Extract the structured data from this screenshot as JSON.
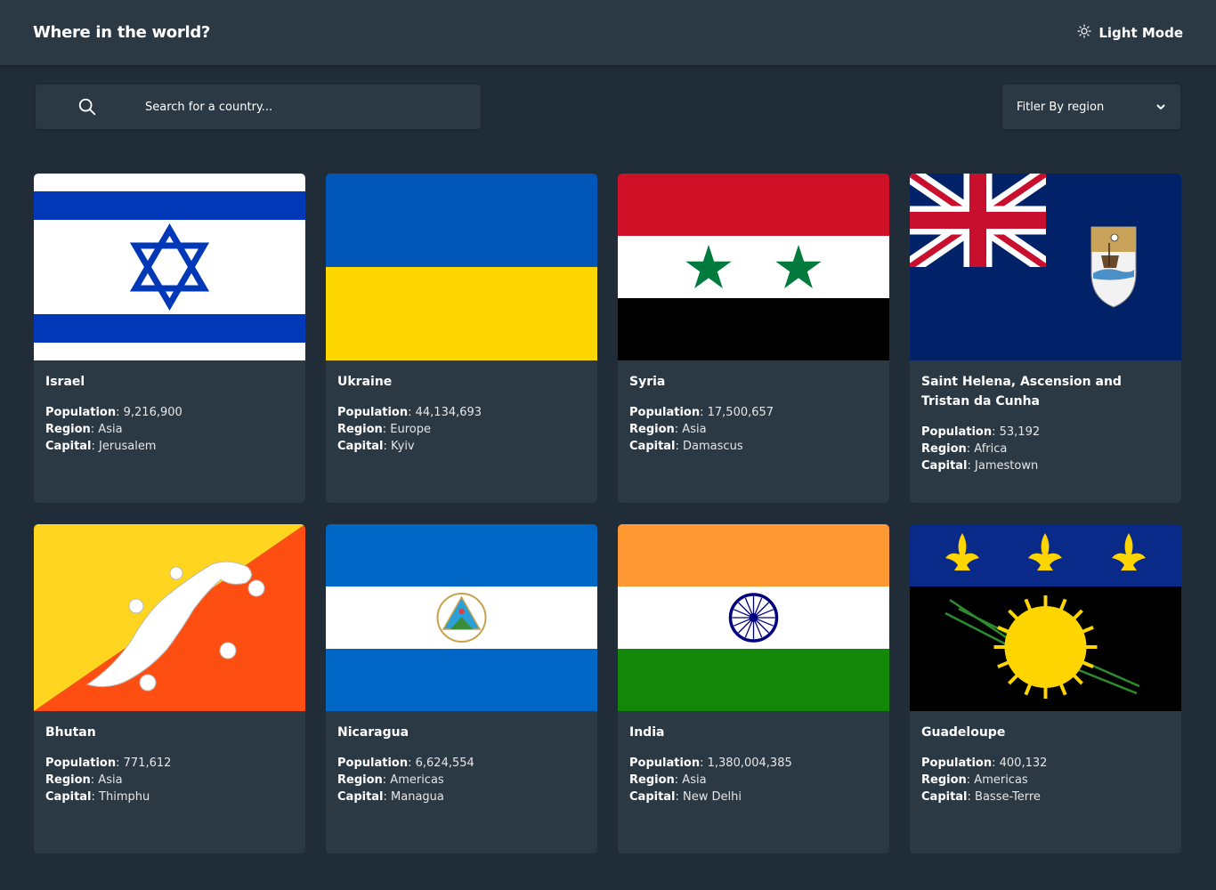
{
  "header": {
    "title": "Where in the world?",
    "theme_toggle_label": "Light Mode"
  },
  "search": {
    "placeholder": "Search for a country..."
  },
  "filter": {
    "label": "Fitler By region"
  },
  "labels": {
    "population": "Population",
    "region": "Region",
    "capital": "Capital"
  },
  "countries": [
    {
      "name": "Israel",
      "population": "9,216,900",
      "region": "Asia",
      "capital": "Jerusalem"
    },
    {
      "name": "Ukraine",
      "population": "44,134,693",
      "region": "Europe",
      "capital": "Kyiv"
    },
    {
      "name": "Syria",
      "population": "17,500,657",
      "region": "Asia",
      "capital": "Damascus"
    },
    {
      "name": "Saint Helena, Ascension and Tristan da Cunha",
      "population": "53,192",
      "region": "Africa",
      "capital": "Jamestown"
    },
    {
      "name": "Bhutan",
      "population": "771,612",
      "region": "Asia",
      "capital": "Thimphu"
    },
    {
      "name": "Nicaragua",
      "population": "6,624,554",
      "region": "Americas",
      "capital": "Managua"
    },
    {
      "name": "India",
      "population": "1,380,004,385",
      "region": "Asia",
      "capital": "New Delhi"
    },
    {
      "name": "Guadeloupe",
      "population": "400,132",
      "region": "Americas",
      "capital": "Basse-Terre"
    }
  ],
  "colors": {
    "background": "#202c37",
    "elements": "#2b3945",
    "text": "#ffffff"
  }
}
